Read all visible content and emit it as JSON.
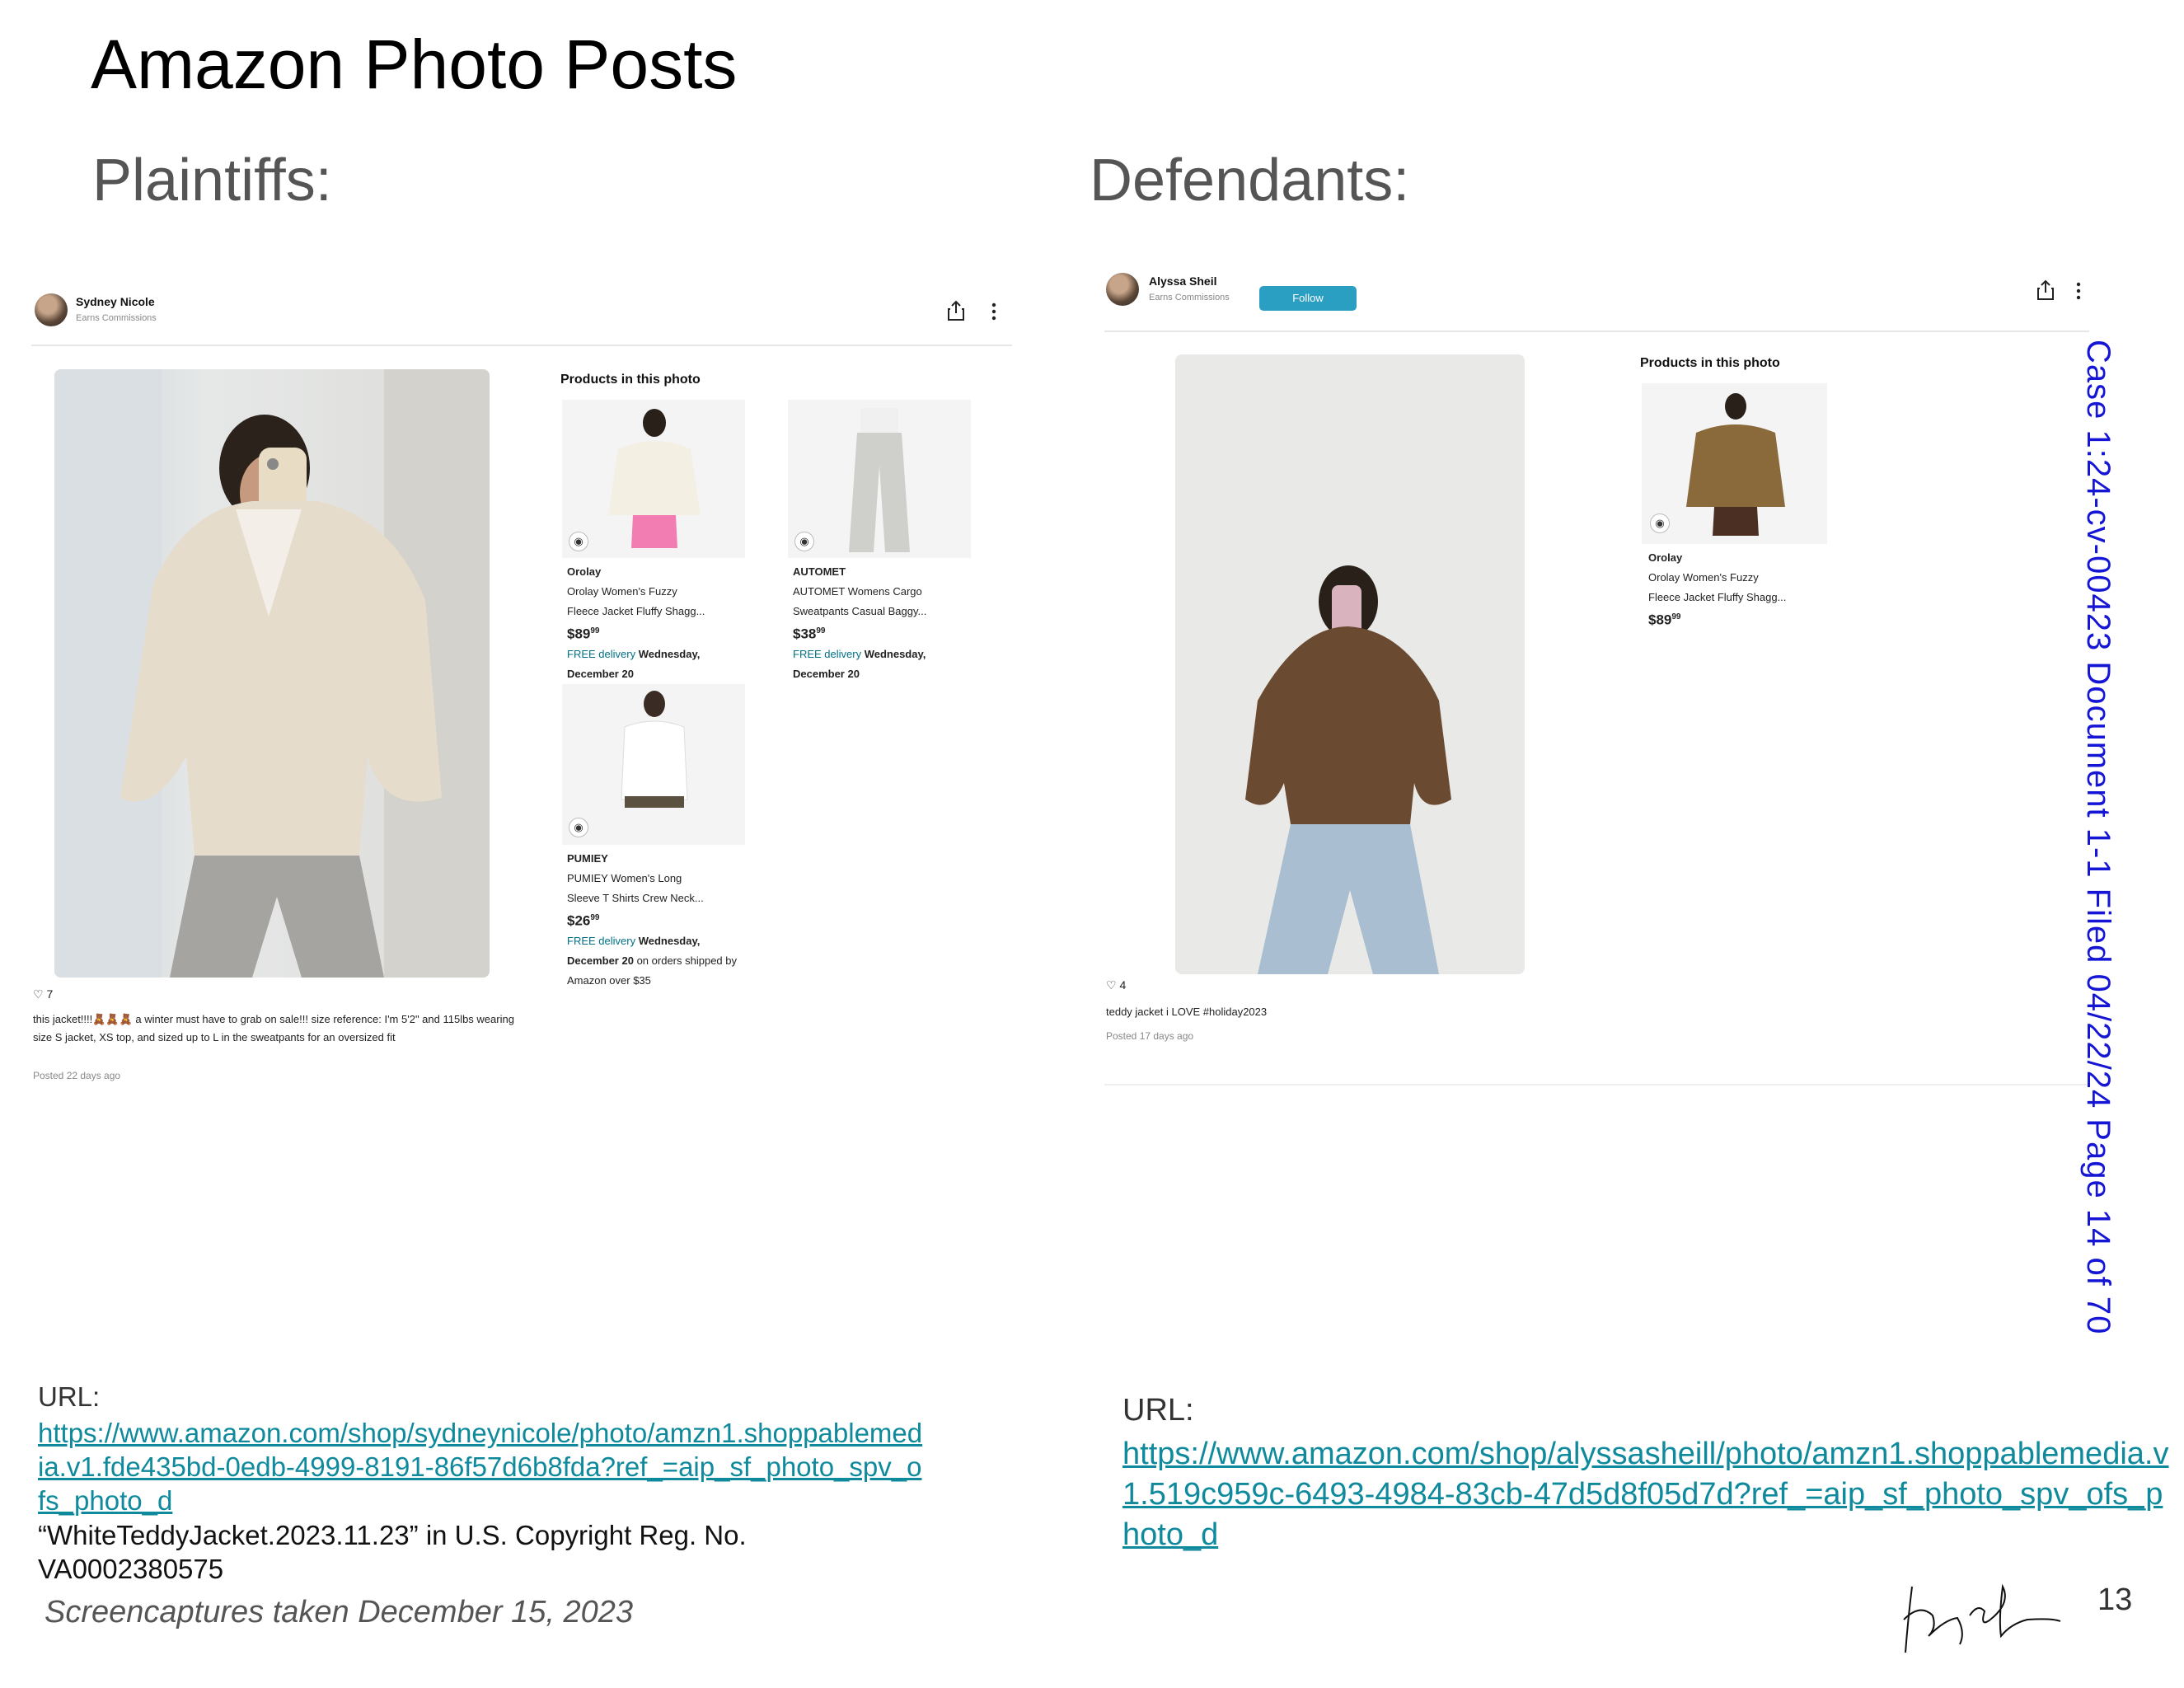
{
  "title": "Amazon Photo Posts",
  "plaintiffs_heading": "Plaintiffs:",
  "defendants_heading": "Defendants:",
  "left_post": {
    "author": "Sydney Nicole",
    "earns": "Earns Commissions",
    "products_heading": "Products in this photo",
    "products": [
      {
        "brand": "Orolay",
        "name": "Orolay Women's Fuzzy",
        "name2": "Fleece Jacket Fluffy Shagg...",
        "price_main": "$89",
        "price_cents": "99",
        "delivery_free": "FREE delivery",
        "delivery_day": "Wednesday,",
        "delivery_date": "December 20",
        "delivery_extra": "",
        "delivery_extra2": ""
      },
      {
        "brand": "AUTOMET",
        "name": "AUTOMET Womens Cargo",
        "name2": "Sweatpants Casual Baggy...",
        "price_main": "$38",
        "price_cents": "99",
        "delivery_free": "FREE delivery",
        "delivery_day": "Wednesday,",
        "delivery_date": "December 20",
        "delivery_extra": "",
        "delivery_extra2": ""
      },
      {
        "brand": "PUMIEY",
        "name": "PUMIEY Women's Long",
        "name2": "Sleeve T Shirts Crew Neck...",
        "price_main": "$26",
        "price_cents": "99",
        "delivery_free": "FREE delivery",
        "delivery_day": "Wednesday,",
        "delivery_date": "December 20",
        "delivery_extra": "on orders shipped by",
        "delivery_extra2": "Amazon over $35"
      }
    ],
    "likes": "7",
    "caption": "this jacket!!!!🧸🧸🧸 a winter must have to grab on sale!!! size reference: I'm 5'2\" and 115lbs wearing size S jacket, XS top, and sized up to L in the sweatpants for an oversized fit",
    "posted": "Posted 22 days ago"
  },
  "right_post": {
    "author": "Alyssa Sheil",
    "earns": "Earns Commissions",
    "follow": "Follow",
    "products_heading": "Products in this photo",
    "product": {
      "brand": "Orolay",
      "name": "Orolay Women's Fuzzy",
      "name2": "Fleece Jacket Fluffy Shagg...",
      "price_main": "$89",
      "price_cents": "99"
    },
    "likes": "4",
    "caption": "teddy jacket i LOVE #holiday2023",
    "posted": "Posted 17 days ago"
  },
  "left_url_label": "URL:",
  "left_url": "https://www.amazon.com/shop/sydneynicole/photo/amzn1.shoppablemedia.v1.fde435bd-0edb-4999-8191-86f57d6b8fda?ref_=aip_sf_photo_spv_ofs_photo_d",
  "copyright_note": "“WhiteTeddyJacket.2023.11.23” in U.S. Copyright Reg. No. VA0002380575",
  "screencapture_note": "Screencaptures taken December 15, 2023",
  "right_url_label": "URL:",
  "right_url": "https://www.amazon.com/shop/alyssasheill/photo/amzn1.shoppablemedia.v1.519c959c-6493-4984-83cb-47d5d8f05d7d?ref_=aip_sf_photo_spv_ofs_photo_d",
  "case_stamp": "Case 1:24-cv-00423   Document 1-1   Filed 04/22/24   Page 14 of 70",
  "page_number": "13",
  "icons": [
    "share-icon",
    "more-vert-icon",
    "eye-icon",
    "heart-icon"
  ],
  "colors": {
    "link": "#0f8a9d",
    "stamp": "#1515d6",
    "follow": "#2a9fc1",
    "delivery": "#007185"
  }
}
